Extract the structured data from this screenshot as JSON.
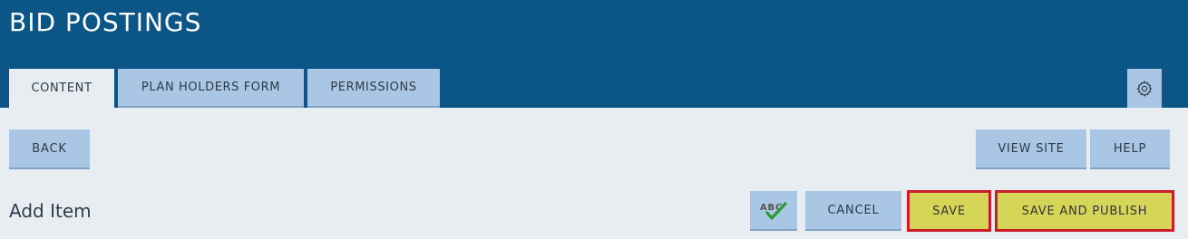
{
  "header": {
    "title": "BID POSTINGS",
    "tabs": [
      {
        "label": "CONTENT",
        "active": true
      },
      {
        "label": "PLAN HOLDERS FORM",
        "active": false
      },
      {
        "label": "PERMISSIONS",
        "active": false
      }
    ],
    "settings_icon": "gear-icon"
  },
  "toolbar": {
    "back_label": "BACK",
    "view_site_label": "VIEW SITE",
    "help_label": "HELP"
  },
  "form": {
    "heading": "Add Item",
    "spellcheck_icon": "spellcheck-abc-icon",
    "spellcheck_text": "ABC",
    "cancel_label": "CANCEL",
    "save_label": "SAVE",
    "save_publish_label": "SAVE AND PUBLISH"
  },
  "colors": {
    "header_bg": "#0c5587",
    "tab_bg": "#a9c6e4",
    "page_bg": "#e8edf2",
    "save_bg": "#d5d657",
    "highlight_border": "#cc1d2a"
  }
}
